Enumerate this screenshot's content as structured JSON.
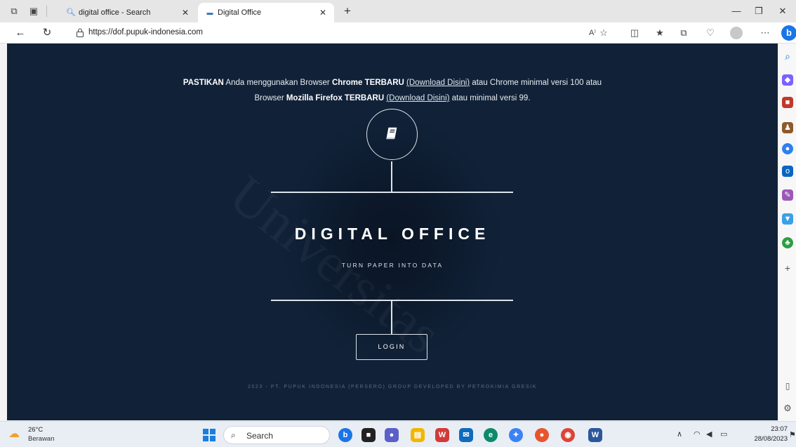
{
  "browser": {
    "tabs": [
      {
        "label": "digital office - Search",
        "icon": "search-icon"
      },
      {
        "label": "Digital Office",
        "icon": "site-favicon"
      }
    ],
    "new_tab_label": "+",
    "address": "https://dof.pupuk-indonesia.com",
    "read_aloud_label": "A⁾",
    "more_label": "⋯"
  },
  "page": {
    "notice": {
      "line1_strong": "PASTIKAN",
      "line1_a": " Anda menggunakan Browser ",
      "line1_browser": "Chrome TERBARU",
      "line1_space": " ",
      "line1_link": "(Download Disini)",
      "line1_b": " atau Chrome minimal versi 100 atau",
      "line2_a": "Browser ",
      "line2_browser": "Mozilla Firefox TERBARU",
      "line2_space": " ",
      "line2_link": "(Download Disini)",
      "line2_b": " atau minimal versi 99."
    },
    "logo_icon": "book-icon",
    "title": "DIGITAL OFFICE",
    "tagline": "TURN PAPER INTO DATA",
    "login_label": "LOGIN",
    "footer": "2023 - PT. PUPUK INDONESIA (PERSERO) GROUP DEVELOPED BY PETROKIMIA GRESIK",
    "watermark": "Universitas"
  },
  "taskbar": {
    "temperature": "26°C",
    "condition": "Berawan",
    "search_label": "Search",
    "time": "23:07",
    "date": "28/08/2023"
  },
  "colors": {
    "page_bg": "#0d1b2e",
    "accent": "#1b74e8",
    "line": "#dde3ea"
  }
}
